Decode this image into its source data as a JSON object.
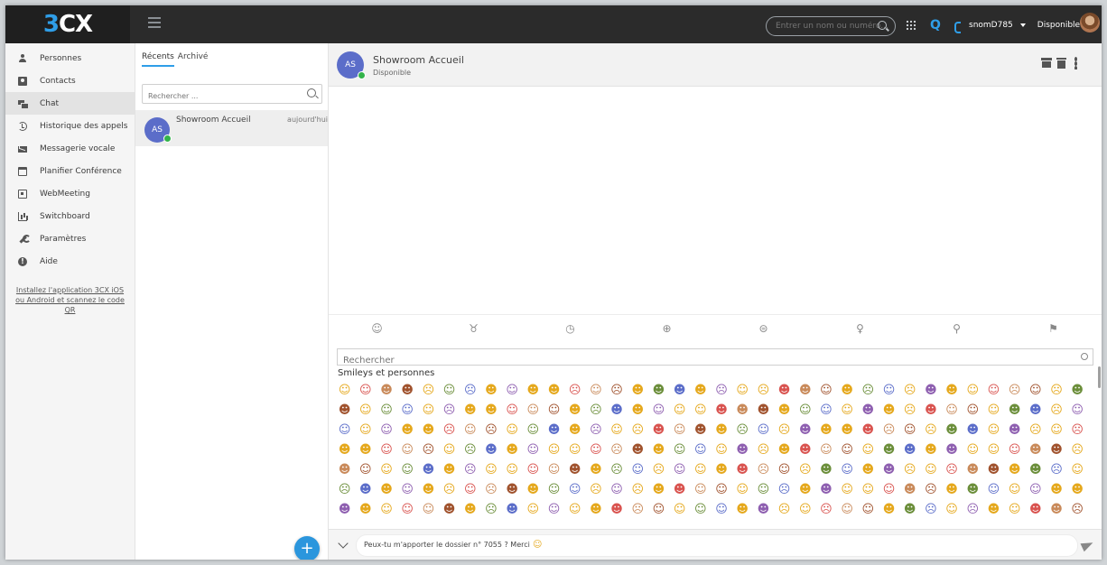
{
  "brand": {
    "part1": "3",
    "part2": "CX"
  },
  "topbar": {
    "search_placeholder": "Entrer un nom ou numéro...",
    "q_label": "Q",
    "extension": "snomD785",
    "status": "Disponible"
  },
  "sidebar": {
    "items": [
      {
        "label": "Personnes",
        "icon": "person-icon"
      },
      {
        "label": "Contacts",
        "icon": "contacts-icon"
      },
      {
        "label": "Chat",
        "icon": "chat-icon",
        "active": true
      },
      {
        "label": "Historique des appels",
        "icon": "history-icon"
      },
      {
        "label": "Messagerie vocale",
        "icon": "voicemail-icon"
      },
      {
        "label": "Planifier Conférence",
        "icon": "calendar-icon"
      },
      {
        "label": "WebMeeting",
        "icon": "webmeeting-icon"
      },
      {
        "label": "Switchboard",
        "icon": "switchboard-icon"
      },
      {
        "label": "Paramètres",
        "icon": "wrench-icon"
      },
      {
        "label": "Aide",
        "icon": "help-icon"
      }
    ],
    "install_text": "Installez l'application 3CX iOS ou Android et scannez le code QR"
  },
  "conversations": {
    "tab_recents": "Récents",
    "tab_archive": "Archivé",
    "search_placeholder": "Rechercher ...",
    "items": [
      {
        "initials": "AS",
        "name": "Showroom Accueil",
        "time": "aujourd'hui"
      }
    ],
    "fab_label": "+"
  },
  "chat": {
    "initials": "AS",
    "name": "Showroom Accueil",
    "status": "Disponible",
    "emoji_tabs": [
      "☺",
      "♉",
      "◷",
      "⊕",
      "⊜",
      "♀",
      "⚲",
      "⚑"
    ],
    "emoji_search_placeholder": "Rechercher",
    "emoji_category": "Smileys et personnes",
    "message": "Peux-tu m'apporter le dossier n° 7055 ? Merci",
    "message_emoji": "☺"
  },
  "colors": {
    "accent": "#2f9ee8",
    "avatar": "#5b6dc9",
    "online": "#33b34a",
    "topbar": "#2b2b2b"
  }
}
